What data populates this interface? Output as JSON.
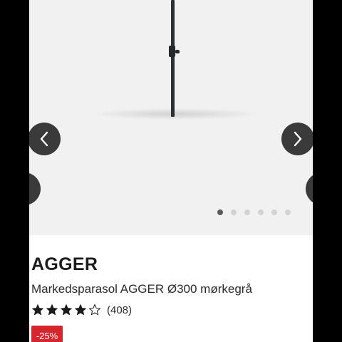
{
  "gallery": {
    "slide_count": 6,
    "active_slide": 1,
    "prev_icon": "chevron-left-icon",
    "next_icon": "chevron-right-icon"
  },
  "product": {
    "brand": "AGGER",
    "name": "Markedsparasol AGGER Ø300 mørkegrå",
    "rating": 4,
    "rating_max": 5,
    "review_count": "(408)",
    "discount_badge": "-25%"
  },
  "colors": {
    "badge_bg": "#d6262d",
    "nav_button_bg": "#3a3a3a",
    "gallery_bg": "#f1f1f1"
  }
}
